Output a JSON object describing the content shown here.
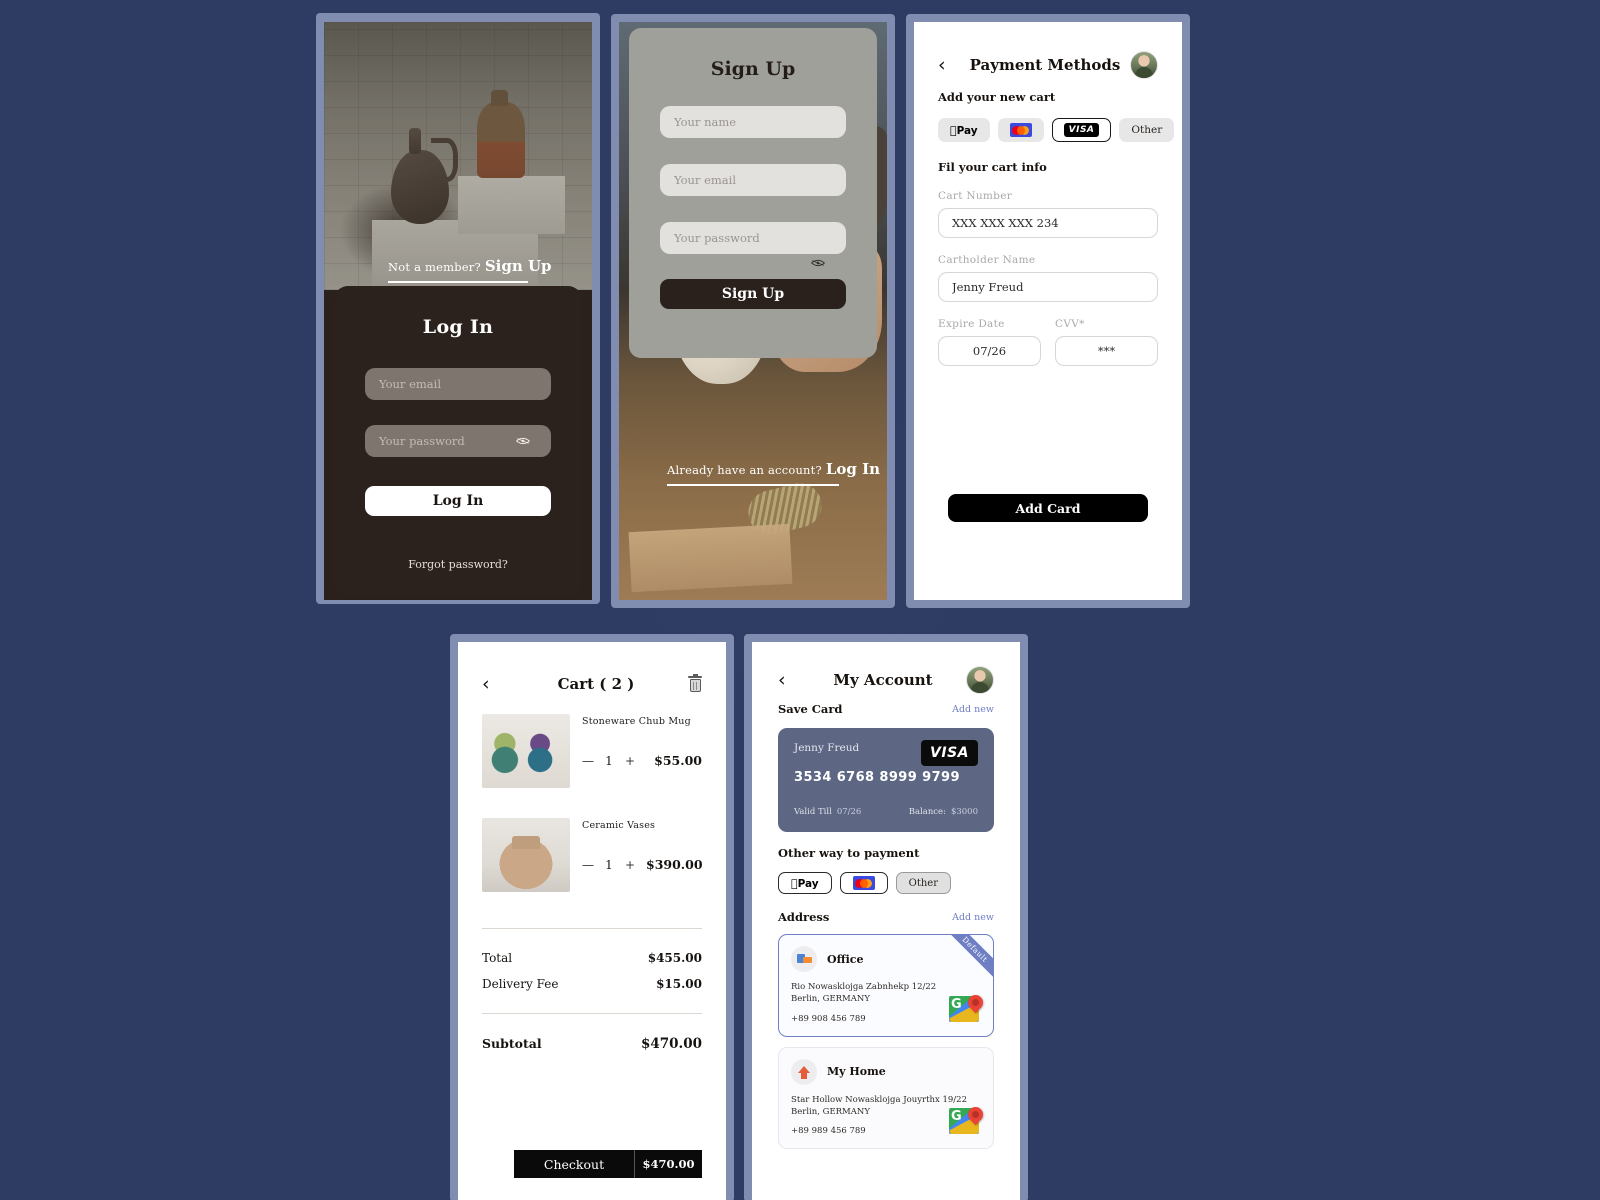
{
  "theme": {
    "background": "#2e3c63",
    "accent": "#6f7fc4",
    "dark": "#2a211c"
  },
  "login": {
    "switch_question": "Not a member?",
    "switch_action": "Sign Up",
    "title": "Log In",
    "email_placeholder": "Your email",
    "password_placeholder": "Your password",
    "submit_label": "Log In",
    "forgot_label": "Forgot password?"
  },
  "signup": {
    "title": "Sign Up",
    "name_placeholder": "Your name",
    "email_placeholder": "Your email",
    "password_placeholder": "Your password",
    "submit_label": "Sign Up",
    "switch_question": "Already have an account?",
    "switch_action": "Log In"
  },
  "payment": {
    "back": "‹",
    "title": "Payment Methods",
    "add_section": "Add your new cart",
    "methods": [
      {
        "id": "applepay",
        "label": "Pay",
        "selected": false
      },
      {
        "id": "mastercard",
        "label": "",
        "selected": false
      },
      {
        "id": "visa",
        "label": "VISA",
        "selected": true
      },
      {
        "id": "other",
        "label": "Other",
        "selected": false
      }
    ],
    "fill_section": "Fil your cart info",
    "fields": {
      "card_number_label": "Cart Number",
      "card_number_value": "XXX XXX XXX 234",
      "holder_label": "Cartholder Name",
      "holder_value": "Jenny Freud",
      "expire_label": "Expire Date",
      "expire_value": "07/26",
      "cvv_label": "CVV*",
      "cvv_value": "***"
    },
    "submit_label": "Add Card"
  },
  "cart": {
    "back": "‹",
    "title": "Cart ( 2 )",
    "delete_icon": "trash-icon",
    "items": [
      {
        "name": "Stoneware Chub Mug",
        "qty": "1",
        "price": "$55.00",
        "minus": "—",
        "plus": "+"
      },
      {
        "name": "Ceramic Vases",
        "qty": "1",
        "price": "$390.00",
        "minus": "—",
        "plus": "+"
      }
    ],
    "totals": [
      {
        "label": "Total",
        "value": "$455.00"
      },
      {
        "label": "Delivery Fee",
        "value": "$15.00"
      }
    ],
    "subtotal_label": "Subtotal",
    "subtotal_value": "$470.00",
    "checkout_label": "Checkout",
    "checkout_total": "$470.00"
  },
  "account": {
    "back": "‹",
    "title": "My Account",
    "save_card_label": "Save Card",
    "add_new_label": "Add new",
    "card": {
      "holder": "Jenny Freud",
      "brand": "VISA",
      "number": "3534 6768 8999 9799",
      "valid_label": "Valid Till",
      "valid_value": "07/26",
      "balance_label": "Balance:",
      "balance_value": "$3000"
    },
    "other_payment_label": "Other way to payment",
    "other_methods": [
      {
        "id": "applepay",
        "label": "Pay"
      },
      {
        "id": "mastercard",
        "label": ""
      },
      {
        "id": "other",
        "label": "Other"
      }
    ],
    "address_label": "Address",
    "address_add_new": "Add new",
    "addresses": [
      {
        "title": "Office",
        "line1": "Rio Nowasklojga Zabnhekp 12/22",
        "line2": "Berlin, GERMANY",
        "phone": "+89 908 456 789",
        "badge": "Default",
        "active": true
      },
      {
        "title": "My Home",
        "line1": "Star Hollow Nowasklojga Jouyrthx 19/22",
        "line2": "Berlin, GERMANY",
        "phone": "+89 989 456 789",
        "badge": "",
        "active": false
      }
    ]
  }
}
